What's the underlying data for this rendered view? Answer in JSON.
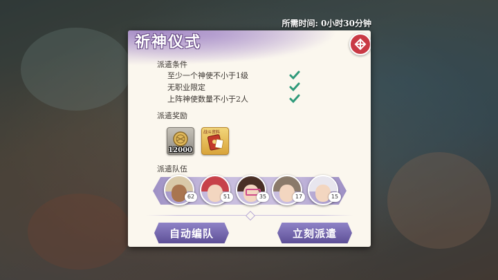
{
  "header": {
    "time_label": "所需时间:",
    "time_value": "0小时30分钟"
  },
  "dialog": {
    "title": "祈神仪式",
    "close_icon": "close-icon",
    "conditions_title": "派遣条件",
    "conditions": [
      {
        "text": "至少一个神使不小于1级",
        "met": true
      },
      {
        "text": "无职业限定",
        "met": true
      },
      {
        "text": "上阵神使数量不小于2人",
        "met": true
      }
    ],
    "rewards_title": "派遣奖励",
    "rewards": [
      {
        "icon": "coin-icon",
        "quantity": "12000"
      },
      {
        "icon": "envelope-card-icon",
        "tag": "战斗资料"
      }
    ],
    "team_title": "派遣队伍",
    "team": [
      {
        "level": "62",
        "hair": "#d9c9a8"
      },
      {
        "level": "51",
        "hair": "#c7424a"
      },
      {
        "level": "35",
        "hair": "#4a3026"
      },
      {
        "level": "17",
        "hair": "#8a7a6a"
      },
      {
        "level": "15",
        "hair": "#e8e6ee"
      }
    ],
    "buttons": {
      "auto": "自动编队",
      "dispatch": "立刻派遣"
    },
    "colors": {
      "accent": "#6a5ca8",
      "check": "#2f9a7a",
      "close": "#c93a45"
    }
  }
}
